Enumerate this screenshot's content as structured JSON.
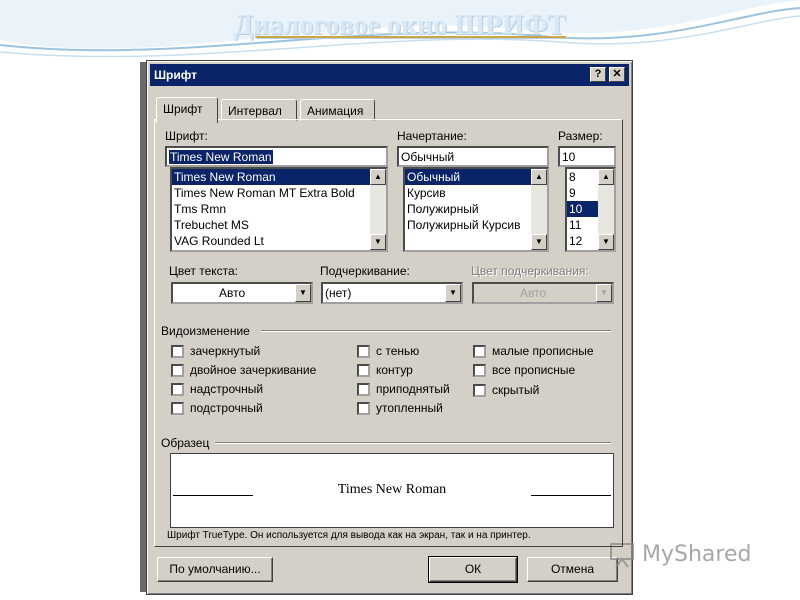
{
  "slide": {
    "title": "Диалоговое окно ШРИФТ"
  },
  "window": {
    "title": "Шрифт",
    "help_glyph": "?",
    "close_glyph": "✕"
  },
  "tabs": [
    {
      "label": "Шрифт",
      "active": true
    },
    {
      "label": "Интервал",
      "active": false
    },
    {
      "label": "Анимация",
      "active": false
    }
  ],
  "font": {
    "label": "Шрифт:",
    "value": "Times New Roman",
    "items": [
      "Times New Roman",
      "Times New Roman MT Extra Bold",
      "Tms Rmn",
      "Trebuchet MS",
      "VAG Rounded Lt"
    ],
    "selected": "Times New Roman"
  },
  "style": {
    "label": "Начертание:",
    "value": "Обычный",
    "items": [
      "Обычный",
      "Курсив",
      "Полужирный",
      "Полужирный Курсив"
    ],
    "selected": "Обычный"
  },
  "size": {
    "label": "Размер:",
    "value": "10",
    "items": [
      "8",
      "9",
      "10",
      "11",
      "12"
    ],
    "selected": "10"
  },
  "color": {
    "label": "Цвет текста:",
    "value": "Авто"
  },
  "underline": {
    "label": "Подчеркивание:",
    "value": "(нет)"
  },
  "underline_color": {
    "label": "Цвет подчеркивания:",
    "value": "Авто",
    "disabled": true
  },
  "effects": {
    "label": "Видоизменение",
    "col1": [
      "зачеркнутый",
      "двойное зачеркивание",
      "надстрочный",
      "подстрочный"
    ],
    "col2": [
      "с тенью",
      "контур",
      "приподнятый",
      "утопленный"
    ],
    "col3": [
      "малые прописные",
      "все прописные",
      "скрытый"
    ]
  },
  "preview": {
    "label": "Образец",
    "sample": "Times New Roman",
    "note": "Шрифт TrueType. Он используется для вывода как на экран, так и на принтер."
  },
  "buttons": {
    "default": "По умолчанию...",
    "ok": "ОК",
    "cancel": "Отмена"
  },
  "watermark": {
    "text": "MyShared"
  },
  "icons": {
    "dropdown": "▼",
    "scroll_up": "▲",
    "scroll_down": "▼"
  }
}
